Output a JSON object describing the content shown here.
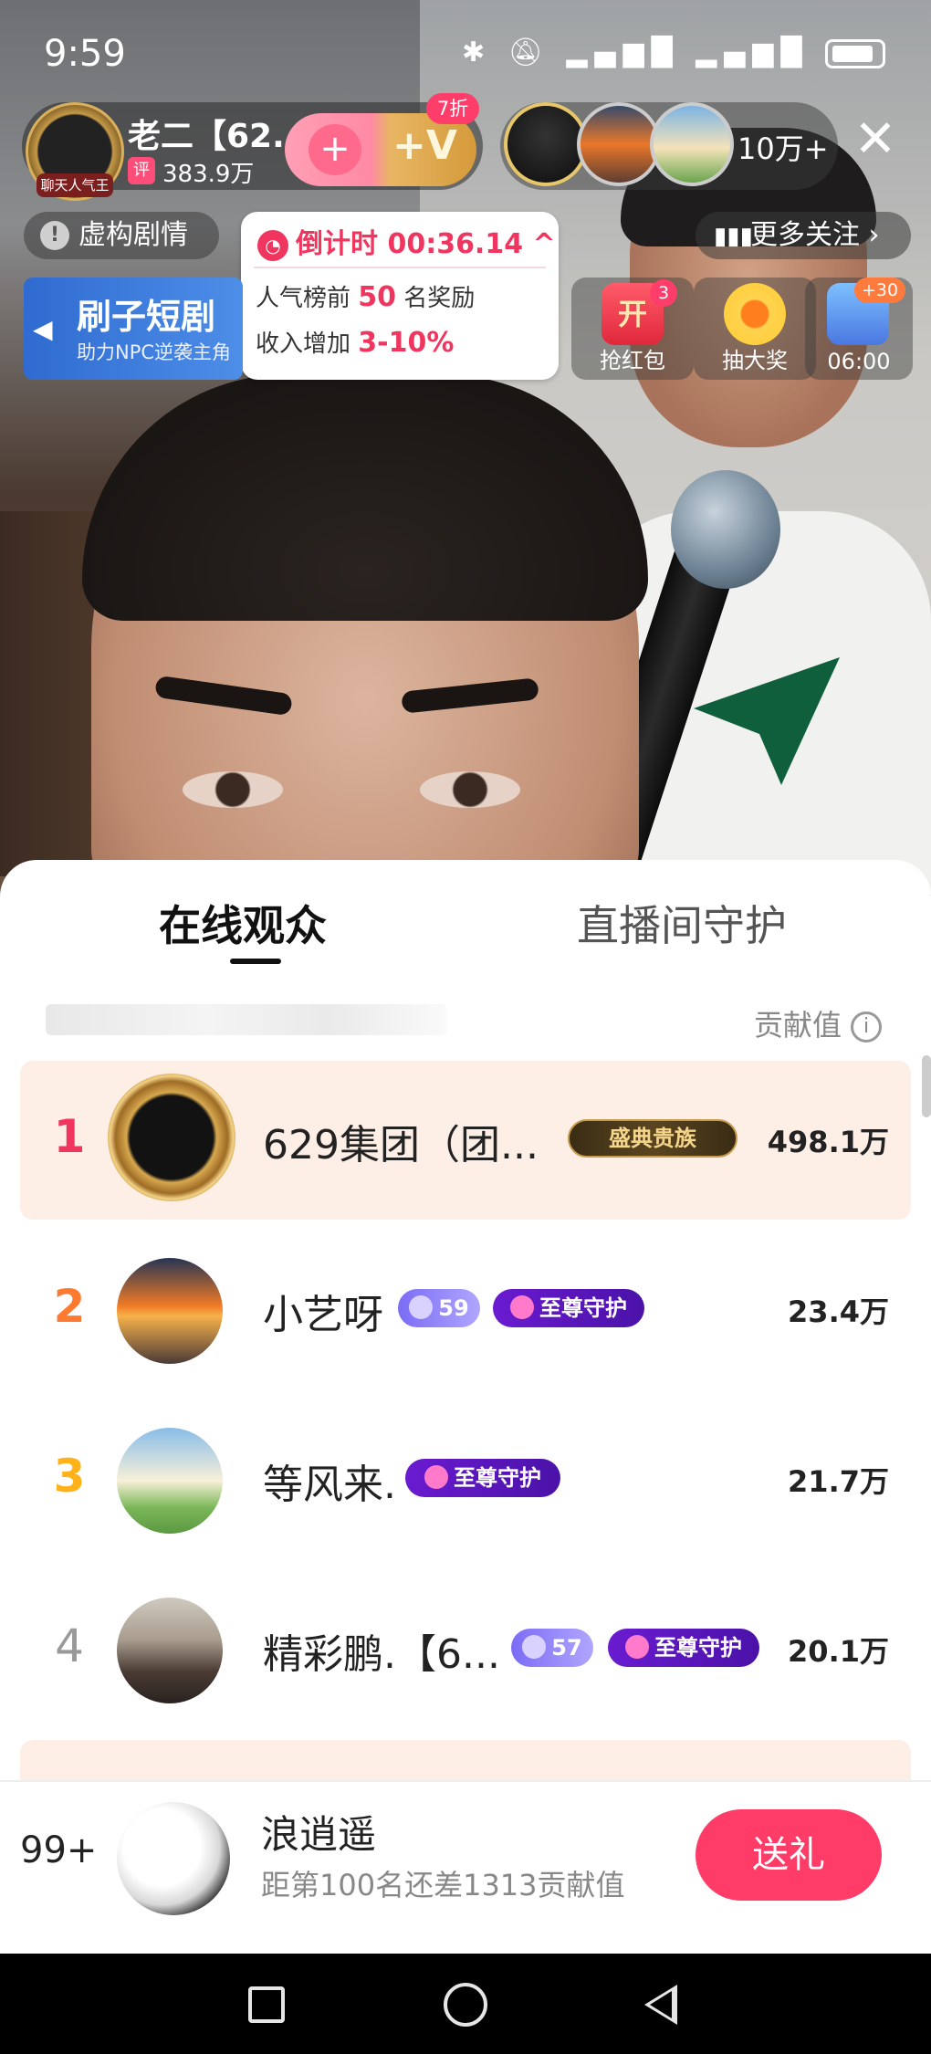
{
  "status_bar": {
    "time": "9:59",
    "icons": [
      "bluetooth-icon",
      "mute-icon",
      "signal-icon",
      "signal-icon",
      "battery-icon"
    ]
  },
  "host": {
    "avatar_label": "聊天人气王",
    "name": "老二【62...",
    "rating_tag": "评",
    "fans": "383.9万",
    "discount": "7折",
    "follow_plus": "+",
    "follow_v": "+V"
  },
  "viewers": {
    "count": "10万+",
    "close": "✕"
  },
  "tags": {
    "fiction": "虚构剧情",
    "more_follow": "更多关注 ›"
  },
  "countdown": {
    "title": "倒计时 00:36.14 ^",
    "row1_prefix": "人气榜前 ",
    "row1_highlight": "50",
    "row1_suffix": " 名奖励",
    "row2_prefix": "收入增加 ",
    "row2_highlight": "3-10%"
  },
  "drama": {
    "title": "刷子短剧",
    "subtitle": "助力NPC逆袭主角"
  },
  "activities": [
    {
      "label": "抢红包",
      "icon_text": "开",
      "badge": "3"
    },
    {
      "label": "抽大奖"
    },
    {
      "label": "06:00",
      "badge": "+30"
    }
  ],
  "tabs": {
    "online": "在线观众",
    "guard": "直播间守护"
  },
  "list_header": {
    "contribution": "贡献值",
    "info_icon": "i"
  },
  "audience": [
    {
      "rank": "1",
      "name": "629集团（团...",
      "badge_noble": "盛典贵族",
      "score": "498.1万"
    },
    {
      "rank": "2",
      "name": "小艺呀",
      "level": "59",
      "guard": "至尊守护",
      "score": "23.4万"
    },
    {
      "rank": "3",
      "name": "等风来.",
      "guard": "至尊守护",
      "score": "21.7万"
    },
    {
      "rank": "4",
      "name": "精彩鹏.【6...",
      "level": "57",
      "guard": "至尊守护",
      "score": "20.1万"
    }
  ],
  "me": {
    "rank": "99+",
    "name": "浪逍遥",
    "sub": "距第100名还差1313贡献值",
    "gift_button": "送礼"
  },
  "colors": {
    "accent": "#ff3b67",
    "rank1": "#f0355f",
    "rank2": "#ff7a2f",
    "rank3": "#ffb21a",
    "guard_badge": "#6a1bd0",
    "drama_blue": "#2f6bd0"
  }
}
